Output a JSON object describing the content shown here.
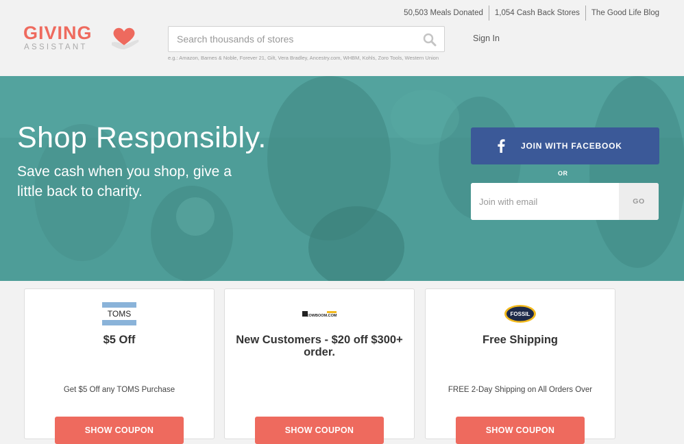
{
  "header": {
    "top_links": [
      {
        "label": "50,503 Meals Donated"
      },
      {
        "label": "1,054 Cash Back Stores"
      },
      {
        "label": "The Good Life Blog"
      }
    ],
    "logo": {
      "line1": "GIVING",
      "line2": "ASSISTANT",
      "icon": "heart-hand-icon"
    },
    "search": {
      "placeholder": "Search thousands of stores",
      "hint": "e.g.: Amazon, Barnes & Noble, Forever 21, Gilt, Vera Bradley, Ancestry.com, WHBM, Kohls, Zoro Tools, Western Union",
      "icon": "search-icon"
    },
    "sign_in": "Sign In"
  },
  "hero": {
    "title": "Shop Responsibly.",
    "subtitle": "Save cash when you shop, give a little back to charity.",
    "facebook_button": "JOIN WITH FACEBOOK",
    "or": "OR",
    "email_placeholder": "Join with email",
    "go_button": "GO"
  },
  "coupons": [
    {
      "brand": "TOMS",
      "title": "$5 Off",
      "description": "Get $5 Off any TOMS Purchase",
      "button": "SHOW COUPON"
    },
    {
      "brand": "COWBOOM.COM",
      "title": "New Customers - $20 off $300+ order.",
      "description": "",
      "button": "SHOW COUPON"
    },
    {
      "brand": "FOSSIL",
      "title": "Free Shipping",
      "description": "FREE 2-Day Shipping on All Orders Over",
      "button": "SHOW COUPON"
    }
  ],
  "colors": {
    "accent": "#ee6a5e",
    "hero_teal": "#4a9a95",
    "facebook": "#3b5998"
  }
}
